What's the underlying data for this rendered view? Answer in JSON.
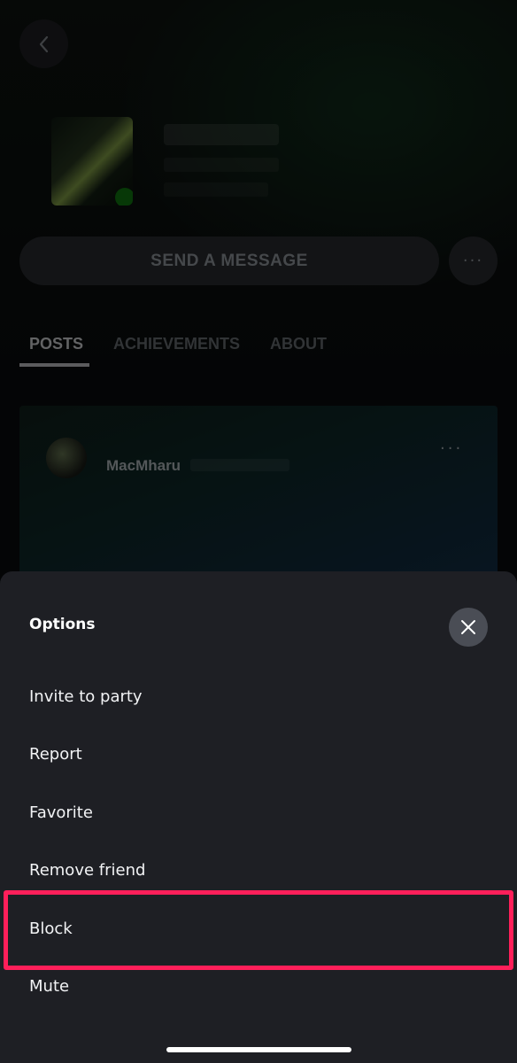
{
  "profile": {
    "send_message_label": "SEND A MESSAGE",
    "more_label": "···"
  },
  "tabs": [
    {
      "label": "POSTS",
      "active": true
    },
    {
      "label": "ACHIEVEMENTS",
      "active": false
    },
    {
      "label": "ABOUT",
      "active": false
    }
  ],
  "post": {
    "username": "MacMharu",
    "more_label": "···"
  },
  "sheet": {
    "title": "Options",
    "items": [
      {
        "label": "Invite to party"
      },
      {
        "label": "Report"
      },
      {
        "label": "Favorite"
      },
      {
        "label": "Remove friend"
      },
      {
        "label": "Block",
        "highlighted": true
      },
      {
        "label": "Mute"
      }
    ]
  },
  "colors": {
    "sheet_bg": "#1e1f24",
    "highlight": "#ff1f5a",
    "xbox_green": "#107c10"
  },
  "icons": {
    "back": "chevron-left-icon",
    "close": "close-icon",
    "more": "more-horizontal-icon"
  }
}
